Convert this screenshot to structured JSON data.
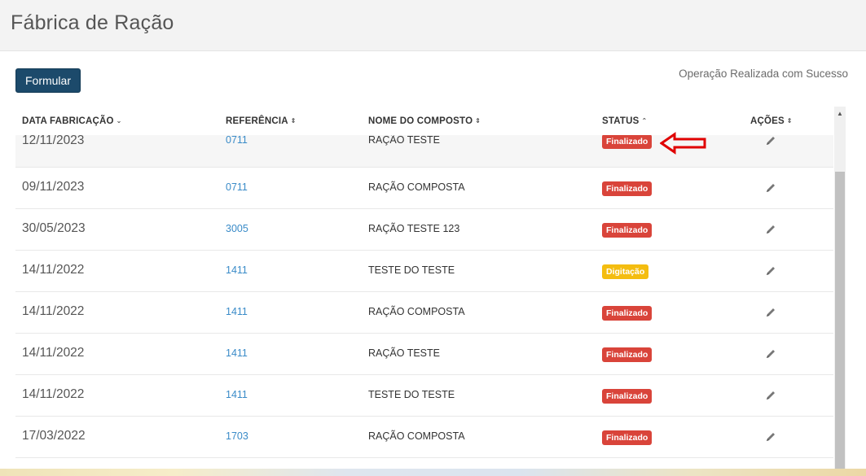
{
  "page": {
    "title": "Fábrica de Ração"
  },
  "toolbar": {
    "formular_label": "Formular"
  },
  "status_message": "Operação Realizada com Sucesso",
  "table": {
    "columns": [
      {
        "label": "DATA FABRICAÇÃO",
        "sort_icon": "⌄"
      },
      {
        "label": "REFERÊNCIA",
        "sort_icon": "⇕"
      },
      {
        "label": "NOME DO COMPOSTO",
        "sort_icon": "⇕"
      },
      {
        "label": "STATUS",
        "sort_icon": "⌃"
      },
      {
        "label": "AÇÕES",
        "sort_icon": "⇕"
      }
    ],
    "rows": [
      {
        "date": "12/11/2023",
        "ref": "0711",
        "name": "RAÇÃO TESTE",
        "status": "Finalizado",
        "status_color": "red"
      },
      {
        "date": "09/11/2023",
        "ref": "0711",
        "name": "RAÇÃO COMPOSTA",
        "status": "Finalizado",
        "status_color": "red"
      },
      {
        "date": "30/05/2023",
        "ref": "3005",
        "name": "RAÇÃO TESTE 123",
        "status": "Finalizado",
        "status_color": "red"
      },
      {
        "date": "14/11/2022",
        "ref": "1411",
        "name": "TESTE DO TESTE",
        "status": "Digitação",
        "status_color": "yellow"
      },
      {
        "date": "14/11/2022",
        "ref": "1411",
        "name": "RAÇÃO COMPOSTA",
        "status": "Finalizado",
        "status_color": "red"
      },
      {
        "date": "14/11/2022",
        "ref": "1411",
        "name": "RAÇÃO TESTE",
        "status": "Finalizado",
        "status_color": "red"
      },
      {
        "date": "14/11/2022",
        "ref": "1411",
        "name": "TESTE DO TESTE",
        "status": "Finalizado",
        "status_color": "red"
      },
      {
        "date": "17/03/2022",
        "ref": "1703",
        "name": "RAÇÃO COMPOSTA",
        "status": "Finalizado",
        "status_color": "red"
      }
    ]
  },
  "icons": {
    "action": "pencil-icon",
    "annotation": "red-arrow-icon"
  },
  "colors": {
    "primary_button": "#1c4a6b",
    "link": "#3a8bc8",
    "badge_finalizado": "#d9443a",
    "badge_digitacao": "#f4bd10",
    "annotation": "#e00000"
  }
}
